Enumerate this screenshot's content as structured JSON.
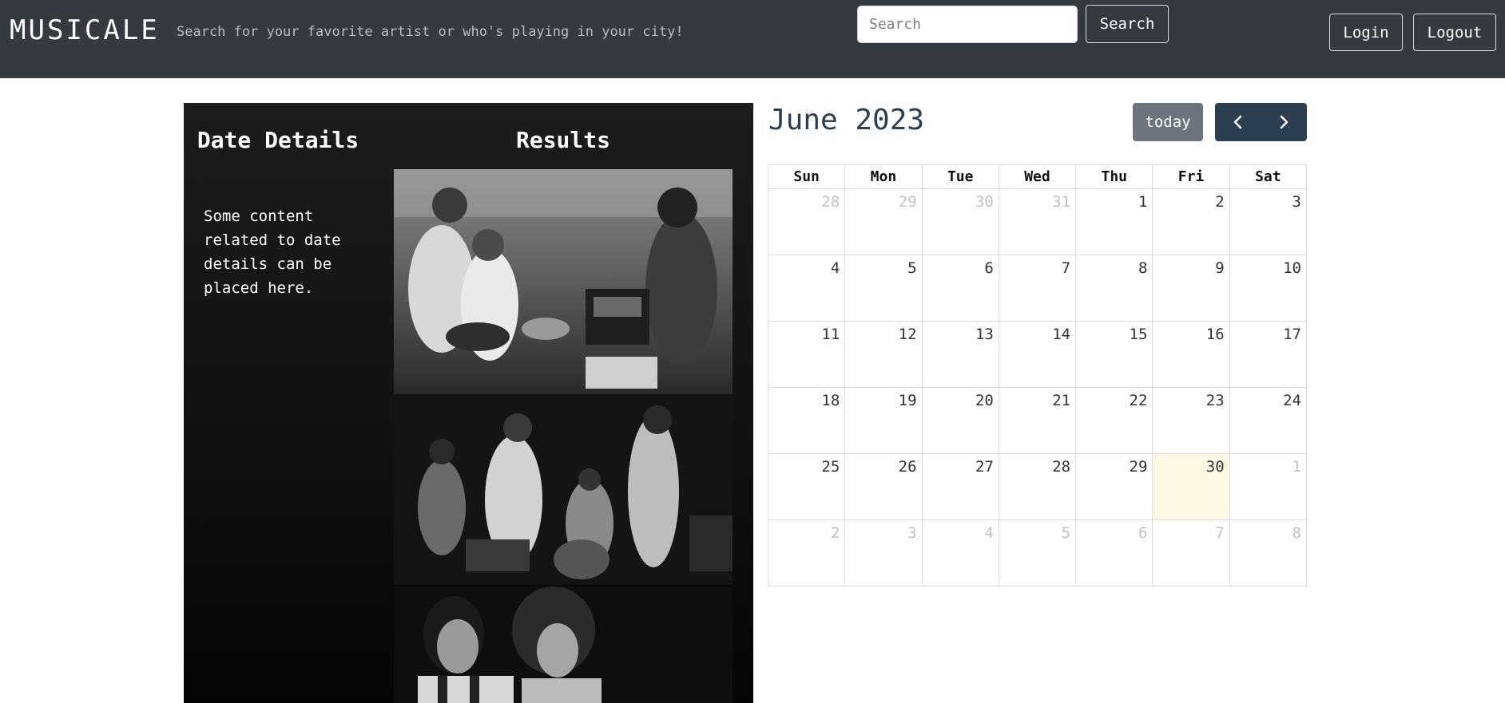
{
  "header": {
    "brand": "MUSICALE",
    "tagline": "Search for your favorite artist or who's playing in your city!",
    "search_placeholder": "Search",
    "search_button": "Search",
    "login_button": "Login",
    "logout_button": "Logout"
  },
  "details": {
    "heading": "Date Details",
    "content": "Some content related to date details can be placed here."
  },
  "results": {
    "heading": "Results"
  },
  "calendar": {
    "title": "June 2023",
    "today_button": "today",
    "prev_icon": "chevron-left-icon",
    "next_icon": "chevron-right-icon",
    "weekdays": [
      "Sun",
      "Mon",
      "Tue",
      "Wed",
      "Thu",
      "Fri",
      "Sat"
    ],
    "weeks": [
      [
        {
          "day": "28",
          "other": true
        },
        {
          "day": "29",
          "other": true
        },
        {
          "day": "30",
          "other": true
        },
        {
          "day": "31",
          "other": true
        },
        {
          "day": "1"
        },
        {
          "day": "2"
        },
        {
          "day": "3"
        }
      ],
      [
        {
          "day": "4"
        },
        {
          "day": "5"
        },
        {
          "day": "6"
        },
        {
          "day": "7"
        },
        {
          "day": "8"
        },
        {
          "day": "9"
        },
        {
          "day": "10"
        }
      ],
      [
        {
          "day": "11"
        },
        {
          "day": "12"
        },
        {
          "day": "13"
        },
        {
          "day": "14"
        },
        {
          "day": "15"
        },
        {
          "day": "16"
        },
        {
          "day": "17"
        }
      ],
      [
        {
          "day": "18"
        },
        {
          "day": "19"
        },
        {
          "day": "20"
        },
        {
          "day": "21"
        },
        {
          "day": "22"
        },
        {
          "day": "23"
        },
        {
          "day": "24"
        }
      ],
      [
        {
          "day": "25"
        },
        {
          "day": "26"
        },
        {
          "day": "27"
        },
        {
          "day": "28"
        },
        {
          "day": "29"
        },
        {
          "day": "30",
          "today": true
        },
        {
          "day": "1",
          "other": true
        }
      ],
      [
        {
          "day": "2",
          "other": true
        },
        {
          "day": "3",
          "other": true
        },
        {
          "day": "4",
          "other": true
        },
        {
          "day": "5",
          "other": true
        },
        {
          "day": "6",
          "other": true
        },
        {
          "day": "7",
          "other": true
        },
        {
          "day": "8",
          "other": true
        }
      ]
    ],
    "today_highlight_color": "#fcf8e3"
  },
  "colors": {
    "navbar": "#343a40",
    "accent": "#2c3e50",
    "secondary": "#6c757d"
  }
}
